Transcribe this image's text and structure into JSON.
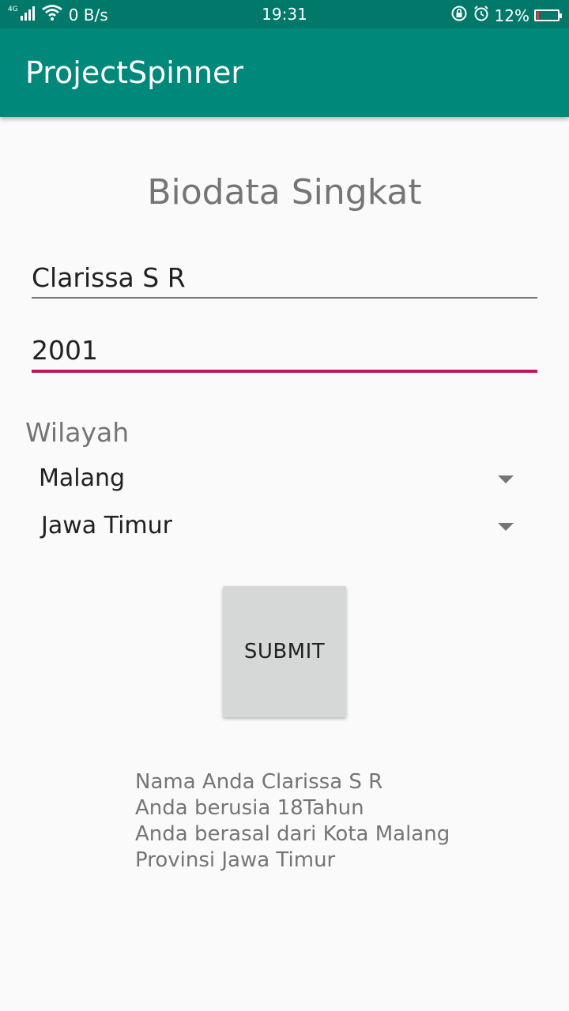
{
  "status_bar": {
    "network": "4G",
    "speed": "0 B/s",
    "time": "19:31",
    "battery": "12%",
    "battery_level": 0.12
  },
  "app_bar": {
    "title": "ProjectSpinner"
  },
  "form": {
    "title": "Biodata Singkat",
    "name_value": "Clarissa S R",
    "year_value": "2001",
    "section_label": "Wilayah",
    "kota_selected": "Malang",
    "provinsi_selected": "Jawa Timur",
    "submit_label": "SUBMIT"
  },
  "result": {
    "line1": "Nama Anda Clarissa S R",
    "line2": "Anda berusia 18Tahun",
    "line3": "Anda berasal dari Kota Malang",
    "line4": "Provinsi Jawa Timur"
  },
  "colors": {
    "status_bar": "#00796b",
    "app_bar": "#00897b",
    "accent": "#c2185b",
    "button": "#d6d7d7"
  }
}
